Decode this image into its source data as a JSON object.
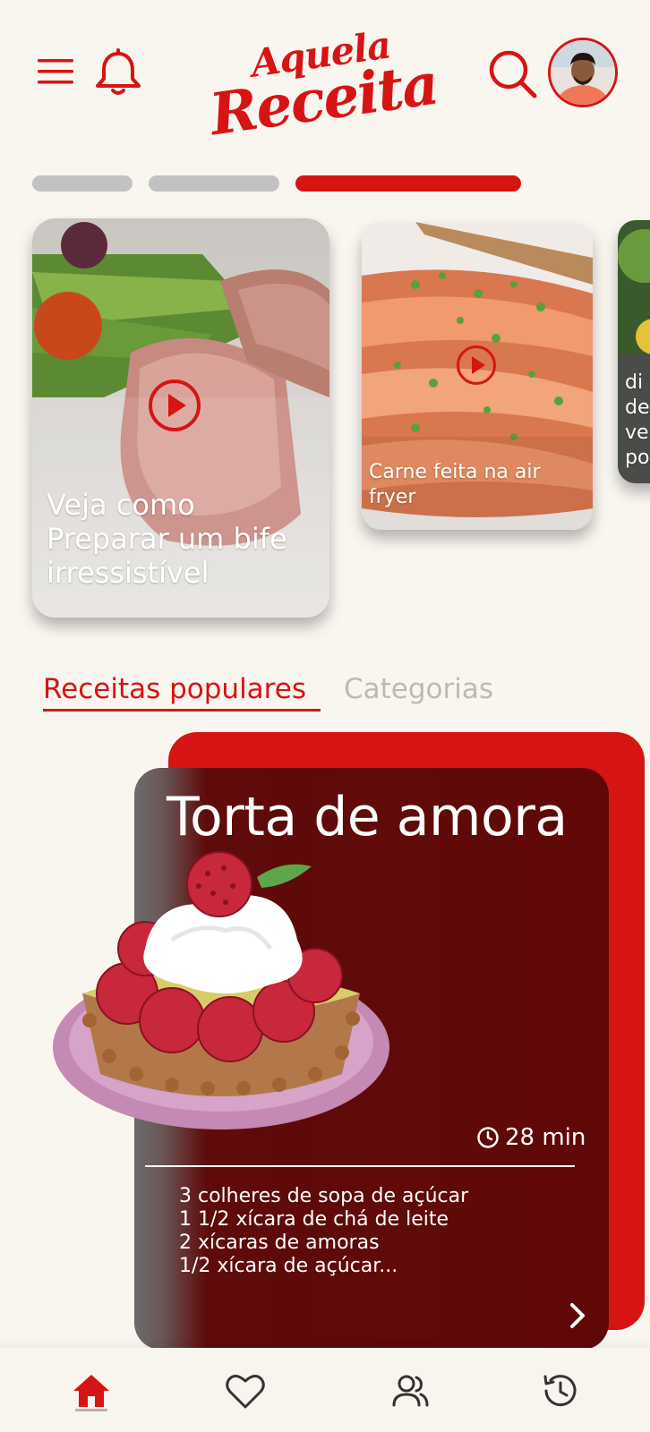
{
  "header": {
    "menu_icon": "hamburger-menu-icon",
    "notification_icon": "bell-icon",
    "logo_line1": "Aquela",
    "logo_line2": "Receita",
    "search_icon": "search-icon",
    "avatar_icon": "user-avatar"
  },
  "stories": {
    "progress": [
      {
        "state": "seen"
      },
      {
        "state": "seen"
      },
      {
        "state": "active"
      }
    ],
    "items": [
      {
        "caption": "Veja como Preparar um bife irressistível",
        "caption_lines": [
          "Veja como",
          "Preparar um bife",
          "irressistível"
        ],
        "play_icon": "play-icon"
      },
      {
        "caption": "Carne feita na air fryer",
        "caption_lines": [
          "Carne feita na air",
          "fryer"
        ],
        "play_icon": "play-icon"
      },
      {
        "caption_lines": [
          "di",
          "de",
          "ve",
          "po"
        ]
      }
    ]
  },
  "tabs": [
    {
      "label": "Receitas populares",
      "active": true
    },
    {
      "label": "Categorias",
      "active": false
    }
  ],
  "recipe": {
    "title": "Torta de amora",
    "time": "28 min",
    "clock_icon": "clock-icon",
    "ingredients": [
      "3 colheres de sopa de açúcar",
      "1 1/2 xícara de chá de leite",
      "2 xícaras de amoras",
      "1/2 xícara de açúcar..."
    ],
    "next_icon": "chevron-right-icon"
  },
  "bottom_nav": [
    {
      "name": "home",
      "icon": "home-icon",
      "active": true
    },
    {
      "name": "favorites",
      "icon": "heart-icon",
      "active": false
    },
    {
      "name": "community",
      "icon": "users-icon",
      "active": false
    },
    {
      "name": "history",
      "icon": "history-icon",
      "active": false
    }
  ],
  "colors": {
    "accent": "#d71414",
    "background": "#f9f6f0",
    "card_dark": "#600808",
    "inactive_tab": "#bdbab6"
  }
}
